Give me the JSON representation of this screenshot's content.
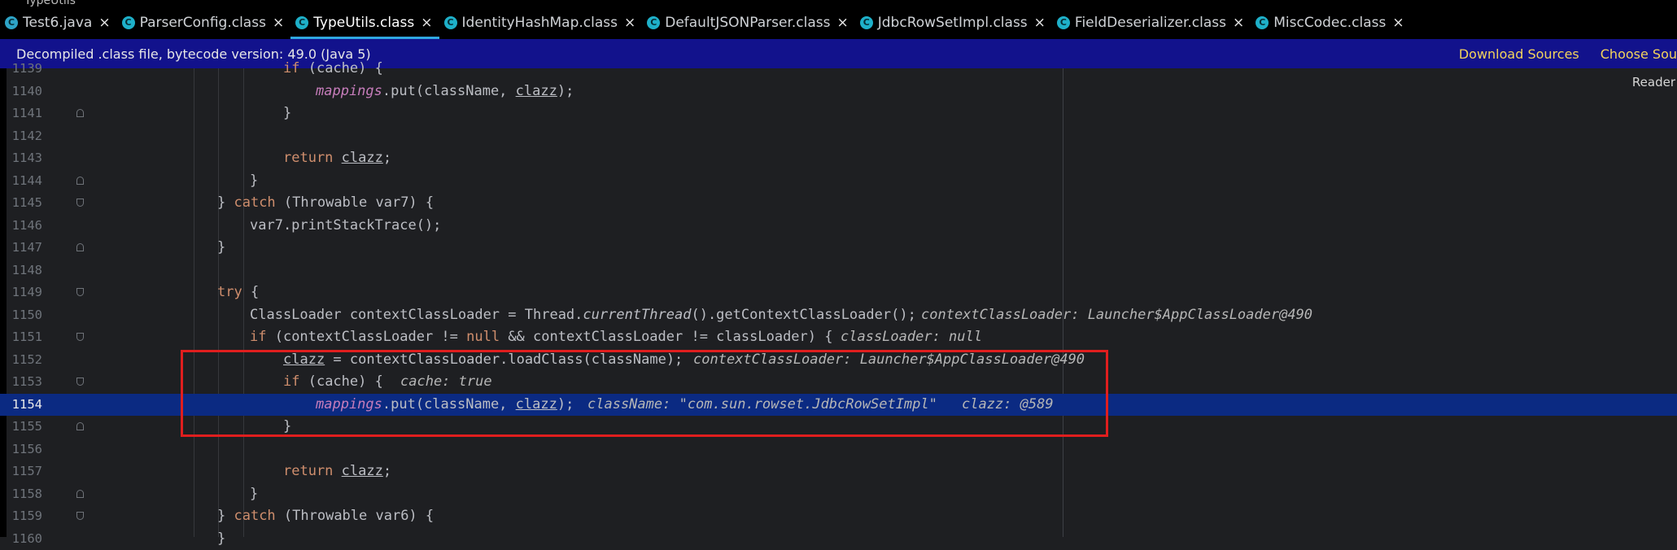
{
  "window": {
    "title": "TypeUtils"
  },
  "tabs": [
    {
      "label": "Test6.java",
      "icon": "java-class-icon",
      "active": false
    },
    {
      "label": "ParserConfig.class",
      "icon": "class-icon",
      "active": false
    },
    {
      "label": "TypeUtils.class",
      "icon": "class-icon",
      "active": true
    },
    {
      "label": "IdentityHashMap.class",
      "icon": "class-icon",
      "active": false
    },
    {
      "label": "DefaultJSONParser.class",
      "icon": "class-icon",
      "active": false
    },
    {
      "label": "JdbcRowSetImpl.class",
      "icon": "class-icon",
      "active": false
    },
    {
      "label": "FieldDeserializer.class",
      "icon": "class-icon",
      "active": false
    },
    {
      "label": "MiscCodec.class",
      "icon": "class-icon",
      "active": false
    }
  ],
  "banner": {
    "message": "Decompiled .class file, bytecode version: 49.0 (Java 5)",
    "download_sources": "Download Sources",
    "choose_sources": "Choose Sou"
  },
  "reader_mode": "Reader",
  "lines": [
    {
      "n": "1139",
      "fold": ""
    },
    {
      "n": "1140",
      "fold": ""
    },
    {
      "n": "1141",
      "fold": "close"
    },
    {
      "n": "1142",
      "fold": ""
    },
    {
      "n": "1143",
      "fold": ""
    },
    {
      "n": "1144",
      "fold": "close"
    },
    {
      "n": "1145",
      "fold": "open"
    },
    {
      "n": "1146",
      "fold": ""
    },
    {
      "n": "1147",
      "fold": "close"
    },
    {
      "n": "1148",
      "fold": ""
    },
    {
      "n": "1149",
      "fold": "open"
    },
    {
      "n": "1150",
      "fold": ""
    },
    {
      "n": "1151",
      "fold": "open"
    },
    {
      "n": "1152",
      "fold": ""
    },
    {
      "n": "1153",
      "fold": "open"
    },
    {
      "n": "1154",
      "fold": ""
    },
    {
      "n": "1155",
      "fold": "close"
    },
    {
      "n": "1156",
      "fold": ""
    },
    {
      "n": "1157",
      "fold": ""
    },
    {
      "n": "1158",
      "fold": "close"
    },
    {
      "n": "1159",
      "fold": "open"
    },
    {
      "n": "1160",
      "fold": ""
    }
  ],
  "code": {
    "l1139": {
      "kw": "if",
      "rest": " (cache) {"
    },
    "l1140": {
      "field": "mappings",
      "a": ".put(className, ",
      "v": "clazz",
      "b": ");"
    },
    "l1141": {
      "t": "}"
    },
    "l1143": {
      "kw": "return ",
      "v": "clazz",
      "b": ";"
    },
    "l1144": {
      "t": "}"
    },
    "l1145": {
      "a": "} ",
      "kw": "catch",
      "b": " (Throwable var7) {"
    },
    "l1146": {
      "t": "var7.printStackTrace();"
    },
    "l1147": {
      "t": "}"
    },
    "l1149": {
      "kw": "try",
      "b": " {"
    },
    "l1150": {
      "a": "ClassLoader contextClassLoader = Thread.",
      "s": "currentThread",
      "b": "().getContextClassLoader();",
      "hint": "contextClassLoader: Launcher$AppClassLoader@490"
    },
    "l1151": {
      "kw": "if",
      "a": " (contextClassLoader != ",
      "kw2": "null",
      "b": " && contextClassLoader != classLoader) {",
      "hint": "classLoader: null"
    },
    "l1152": {
      "v": "clazz",
      "b": " = contextClassLoader.loadClass(className);",
      "hint": "contextClassLoader: Launcher$AppClassLoader@490"
    },
    "l1153": {
      "kw": "if",
      "b": " (cache) {",
      "hint": "cache: true"
    },
    "l1154": {
      "field": "mappings",
      "a": ".put(className, ",
      "v": "clazz",
      "b": ");",
      "hint1": "className: \"com.sun.rowset.JdbcRowSetImpl\"",
      "hint2": "clazz: @589"
    },
    "l1155": {
      "t": "}"
    },
    "l1157": {
      "kw": "return ",
      "v": "clazz",
      "b": ";"
    },
    "l1158": {
      "t": "}"
    },
    "l1159": {
      "a": "} ",
      "kw": "catch",
      "b": " (Throwable var6) {"
    },
    "l1160": {
      "t": "}"
    }
  },
  "colors": {
    "highlight_line": "#0b2a82",
    "banner_bg": "#12128c",
    "annotation_box": "#e01e1e",
    "keyword": "#cf8e6d",
    "field": "#c77dbb"
  }
}
